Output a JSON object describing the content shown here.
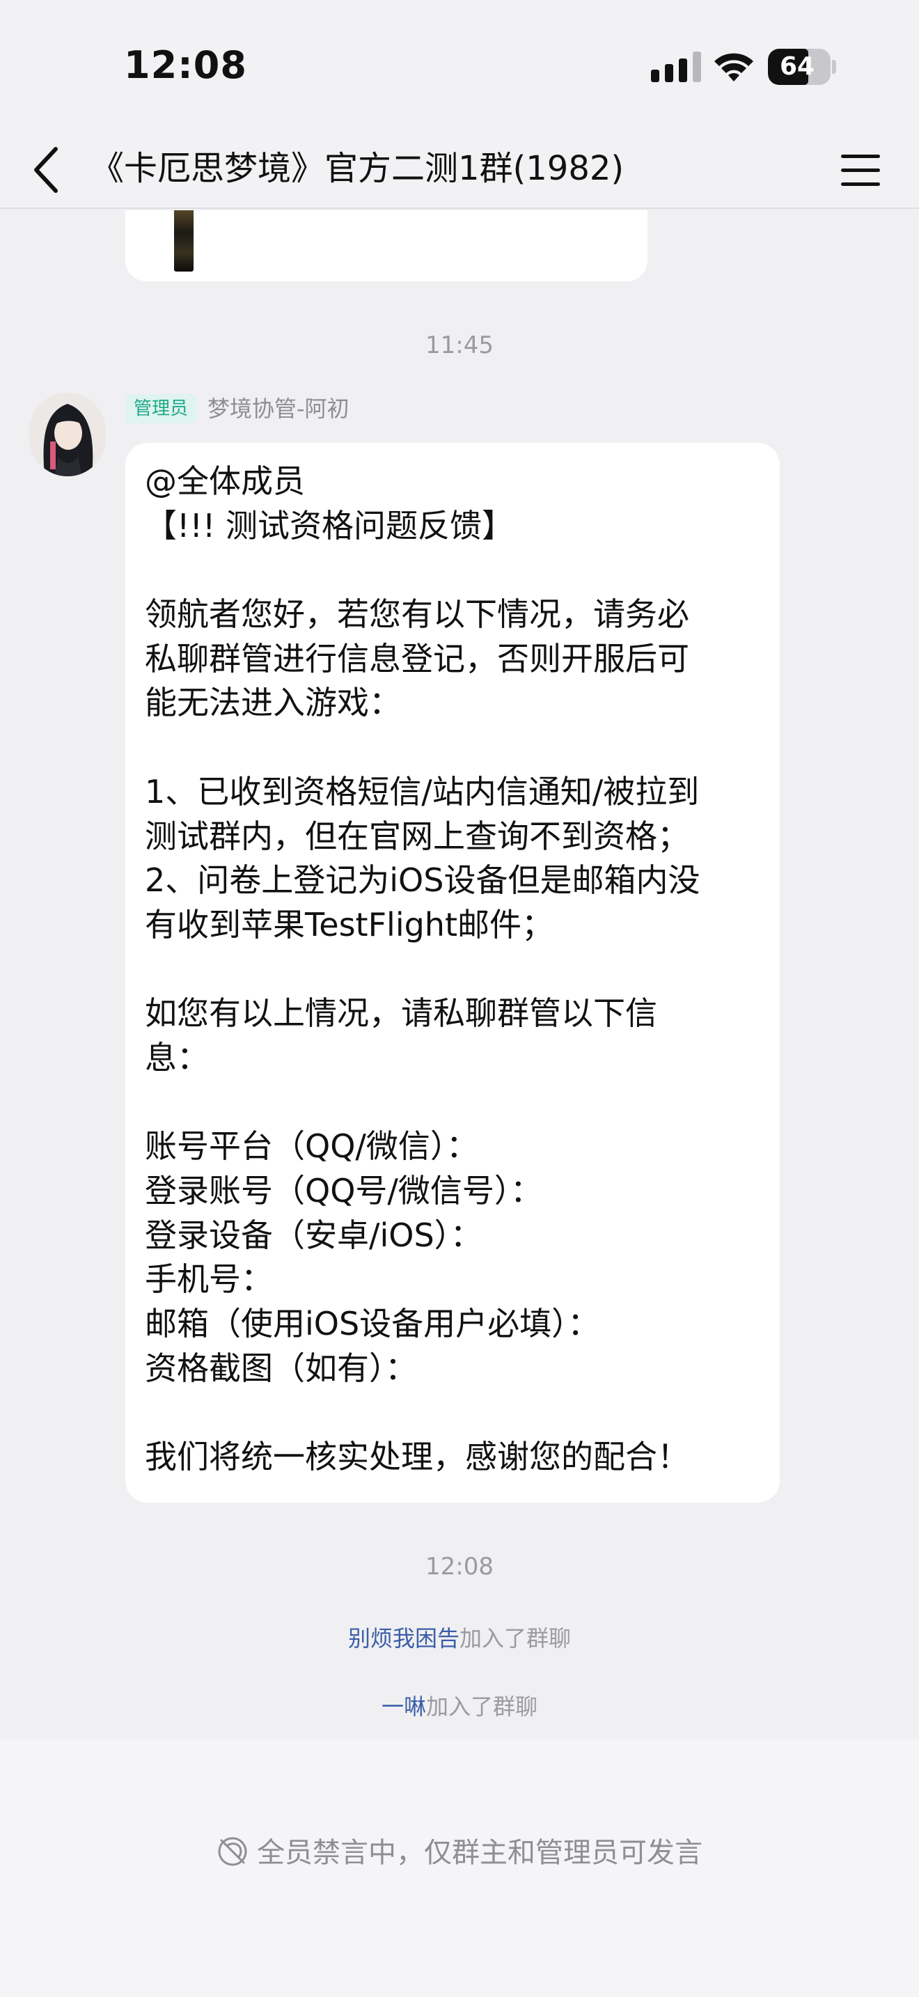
{
  "status_bar": {
    "time": "12:08",
    "battery": "64",
    "battery_level": 0.64
  },
  "header": {
    "title": "《卡厄思梦境》官方二测1群(1982)"
  },
  "messages": {
    "time_1": "11:45",
    "sender": {
      "role": "管理员",
      "name": "梦境协管-阿初"
    },
    "lines": [
      "@全体成员",
      "【!!! 测试资格问题反馈】",
      "",
      "领航者您好，若您有以下情况，请务必",
      "私聊群管进行信息登记，否则开服后可",
      "能无法进入游戏：",
      "",
      "1、已收到资格短信/站内信通知/被拉到",
      "测试群内，但在官网上查询不到资格；",
      "2、问卷上登记为iOS设备但是邮箱内没",
      "有收到苹果TestFlight邮件；",
      "",
      "如您有以上情况，请私聊群管以下信",
      "息：",
      "",
      "账号平台（QQ/微信）：",
      "登录账号（QQ号/微信号）：",
      "登录设备（安卓/iOS）：",
      "手机号：",
      "邮箱（使用iOS设备用户必填）：",
      "资格截图（如有）：",
      "",
      "我们将统一核实处理，感谢您的配合！"
    ],
    "time_2": "12:08",
    "system": [
      {
        "user": "别烦我困告",
        "text": "加入了群聊"
      },
      {
        "user": "一啉",
        "text": "加入了群聊"
      }
    ]
  },
  "footer": {
    "muted_text": "全员禁言中，仅群主和管理员可发言"
  },
  "colors": {
    "accent_link": "#3b5ea8",
    "badge_bg": "#dff3ef",
    "badge_text": "#1fa98a"
  }
}
